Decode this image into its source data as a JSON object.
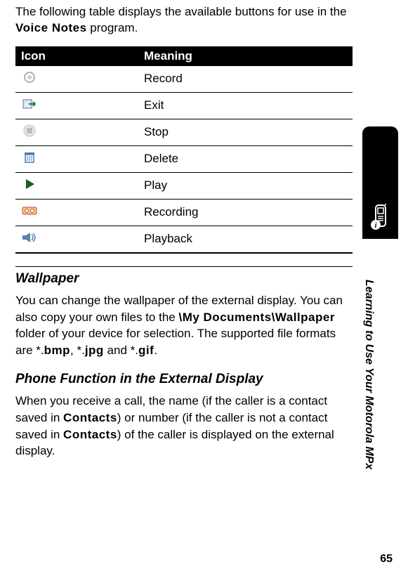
{
  "intro": {
    "prefix": "The following table displays the available buttons for use in the ",
    "program": "Voice Notes",
    "suffix": " program."
  },
  "table": {
    "header_icon": "Icon",
    "header_meaning": "Meaning",
    "rows": [
      {
        "icon": "record-icon",
        "meaning": "Record"
      },
      {
        "icon": "exit-icon",
        "meaning": "Exit"
      },
      {
        "icon": "stop-icon",
        "meaning": "Stop"
      },
      {
        "icon": "delete-icon",
        "meaning": "Delete"
      },
      {
        "icon": "play-icon",
        "meaning": "Play"
      },
      {
        "icon": "recording-icon",
        "meaning": "Recording"
      },
      {
        "icon": "playback-icon",
        "meaning": "Playback"
      }
    ]
  },
  "wallpaper": {
    "heading": "Wallpaper",
    "p1a": "You can change the wallpaper of the external display. You can also copy your own files to the ",
    "path": "\\My Documents\\Wallpaper",
    "p1b": " folder of your device for selection. The supported file formats are *.",
    "ext1": "bmp",
    "sep1": ", *.",
    "ext2": "jpg",
    "sep2": " and *.",
    "ext3": "gif",
    "end": "."
  },
  "phonefn": {
    "heading": "Phone Function in the External Display",
    "p1a": "When you receive a call, the name (if the caller is a contact saved in ",
    "contacts1": "Contacts",
    "p1b": ") or number (if the caller is not a contact saved in ",
    "contacts2": "Contacts",
    "p1c": ") of the caller is displayed on the external display."
  },
  "side": {
    "label": "Learning to Use Your Motorola MPx"
  },
  "page_number": "65"
}
